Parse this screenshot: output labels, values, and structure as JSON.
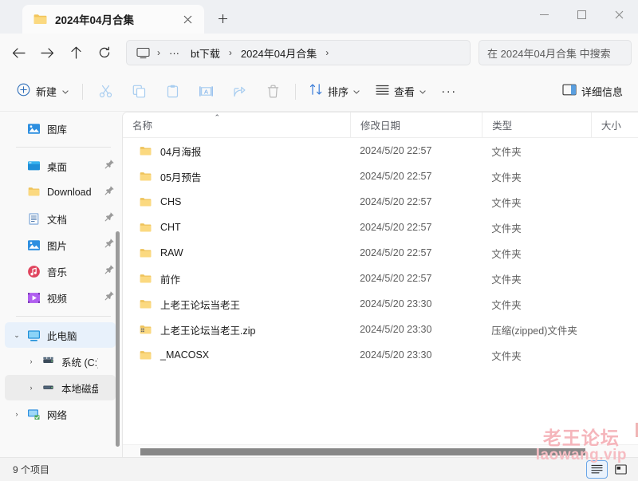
{
  "window": {
    "tab_title": "2024年04月合集",
    "tab_folder_icon": "folder-icon",
    "close_tab_icon": "close-icon",
    "new_tab_icon": "plus-icon",
    "minimize_icon": "minimize-icon",
    "maximize_icon": "maximize-icon",
    "close_icon": "close-icon"
  },
  "nav": {
    "back_icon": "arrow-left-icon",
    "forward_icon": "arrow-right-icon",
    "up_icon": "arrow-up-icon",
    "refresh_icon": "refresh-icon"
  },
  "breadcrumb": {
    "root_icon": "monitor-icon",
    "overflow": "···",
    "items": [
      "bt下载",
      "2024年04月合集"
    ],
    "separator": "›"
  },
  "search": {
    "placeholder": "在 2024年04月合集 中搜索",
    "icon": "search-icon"
  },
  "toolbar": {
    "new_label": "新建",
    "new_icon": "plus-circle-icon",
    "cut_icon": "scissors-icon",
    "copy_icon": "copy-icon",
    "paste_icon": "clipboard-icon",
    "rename_icon": "rename-icon",
    "share_icon": "share-icon",
    "delete_icon": "trash-icon",
    "sort_label": "排序",
    "sort_icon": "sort-icon",
    "view_label": "查看",
    "view_icon": "list-icon",
    "more_label": "···",
    "details_label": "详细信息",
    "details_icon": "details-pane-icon",
    "chevron": "⌄"
  },
  "sidebar": {
    "items": [
      {
        "label": "图库",
        "icon": "gallery-icon",
        "pinned": false,
        "indent": 0,
        "state": "normal",
        "twisty": ""
      },
      {
        "divider": true
      },
      {
        "label": "桌面",
        "icon": "desktop-icon",
        "pinned": true,
        "indent": 0,
        "state": "normal",
        "twisty": ""
      },
      {
        "label": "Download",
        "icon": "folder-icon",
        "pinned": true,
        "indent": 0,
        "state": "normal",
        "twisty": ""
      },
      {
        "label": "文档",
        "icon": "documents-icon",
        "pinned": true,
        "indent": 0,
        "state": "normal",
        "twisty": ""
      },
      {
        "label": "图片",
        "icon": "pictures-icon",
        "pinned": true,
        "indent": 0,
        "state": "normal",
        "twisty": ""
      },
      {
        "label": "音乐",
        "icon": "music-icon",
        "pinned": true,
        "indent": 0,
        "state": "normal",
        "twisty": ""
      },
      {
        "label": "视频",
        "icon": "videos-icon",
        "pinned": true,
        "indent": 0,
        "state": "normal",
        "twisty": ""
      },
      {
        "divider": true
      },
      {
        "label": "此电脑",
        "icon": "this-pc-icon",
        "pinned": false,
        "indent": 0,
        "state": "selected",
        "twisty": "⌄"
      },
      {
        "label": "系统 (C:)",
        "icon": "system-drive-icon",
        "pinned": false,
        "indent": 1,
        "state": "normal",
        "twisty": "›"
      },
      {
        "label": "本地磁盘 (D:)",
        "icon": "drive-icon",
        "pinned": false,
        "indent": 1,
        "state": "hover",
        "twisty": "›"
      },
      {
        "label": "网络",
        "icon": "network-icon",
        "pinned": false,
        "indent": 0,
        "state": "normal",
        "twisty": "›"
      }
    ],
    "pin_icon": "pin-icon"
  },
  "filelist": {
    "columns": [
      {
        "label": "名称",
        "sorted": "asc",
        "sort_glyph": "⌃"
      },
      {
        "label": "修改日期",
        "sorted": "",
        "sort_glyph": ""
      },
      {
        "label": "类型",
        "sorted": "",
        "sort_glyph": ""
      },
      {
        "label": "大小",
        "sorted": "",
        "sort_glyph": ""
      }
    ],
    "rows": [
      {
        "name": "04月海报",
        "date": "2024/5/20 22:57",
        "type": "文件夹",
        "size": "",
        "icon": "folder-icon"
      },
      {
        "name": "05月预告",
        "date": "2024/5/20 22:57",
        "type": "文件夹",
        "size": "",
        "icon": "folder-icon"
      },
      {
        "name": "CHS",
        "date": "2024/5/20 22:57",
        "type": "文件夹",
        "size": "",
        "icon": "folder-icon"
      },
      {
        "name": "CHT",
        "date": "2024/5/20 22:57",
        "type": "文件夹",
        "size": "",
        "icon": "folder-icon"
      },
      {
        "name": "RAW",
        "date": "2024/5/20 22:57",
        "type": "文件夹",
        "size": "",
        "icon": "folder-icon"
      },
      {
        "name": "前作",
        "date": "2024/5/20 22:57",
        "type": "文件夹",
        "size": "",
        "icon": "folder-icon"
      },
      {
        "name": "上老王论坛当老王",
        "date": "2024/5/20 23:30",
        "type": "文件夹",
        "size": "",
        "icon": "folder-icon"
      },
      {
        "name": "上老王论坛当老王.zip",
        "date": "2024/5/20 23:30",
        "type": "压缩(zipped)文件夹",
        "size": "",
        "icon": "zip-folder-icon"
      },
      {
        "name": "_MACOSX",
        "date": "2024/5/20 23:30",
        "type": "文件夹",
        "size": "",
        "icon": "folder-icon"
      }
    ]
  },
  "statusbar": {
    "item_count": "9 个项目",
    "details_view_icon": "details-view-icon",
    "large_icons_view_icon": "large-icons-view-icon"
  },
  "watermark": {
    "line1": "老王论坛",
    "line2": "laowang.vip"
  },
  "colors": {
    "accent": "#0078d4",
    "selection": "#e8f1fb",
    "folder": "#f7cb66",
    "watermark": "#f5b5bb",
    "toolbar_icon": "#a8cdf0"
  }
}
